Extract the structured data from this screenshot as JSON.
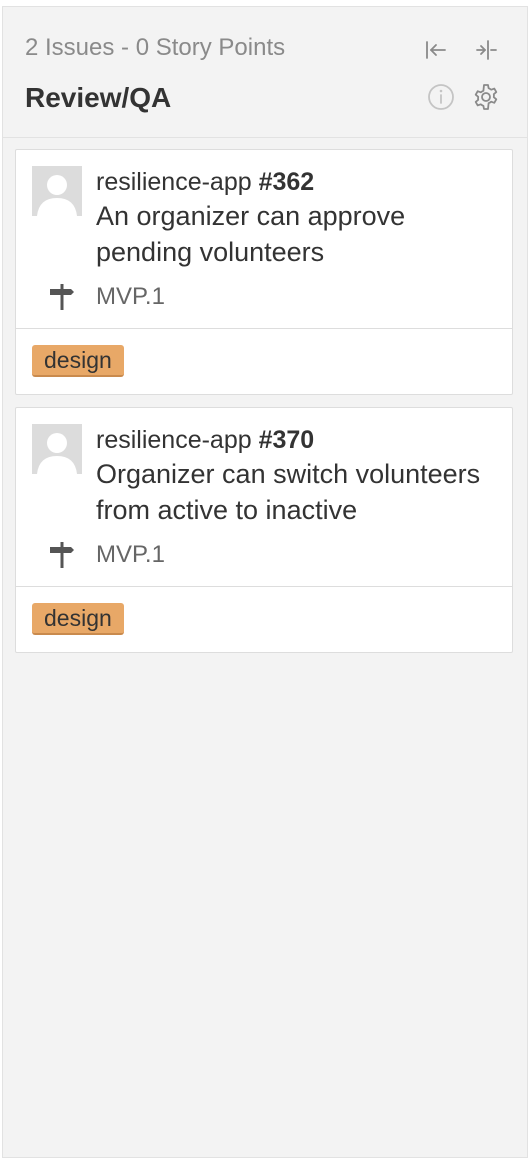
{
  "column": {
    "summary": "2 Issues - 0 Story Points",
    "title": "Review/QA",
    "icons": [
      "collapse-left-icon",
      "collapse-column-icon",
      "info-icon",
      "gear-icon"
    ]
  },
  "cards": [
    {
      "repo": "resilience-app",
      "number": "#362",
      "title": "An organizer can approve pending volunteers",
      "milestone": "MVP.1",
      "labels": [
        {
          "name": "design",
          "color": "#e8a867"
        }
      ]
    },
    {
      "repo": "resilience-app",
      "number": "#370",
      "title": "Organizer can switch volunteers from active to inactive",
      "milestone": "MVP.1",
      "labels": [
        {
          "name": "design",
          "color": "#e8a867"
        }
      ]
    }
  ]
}
